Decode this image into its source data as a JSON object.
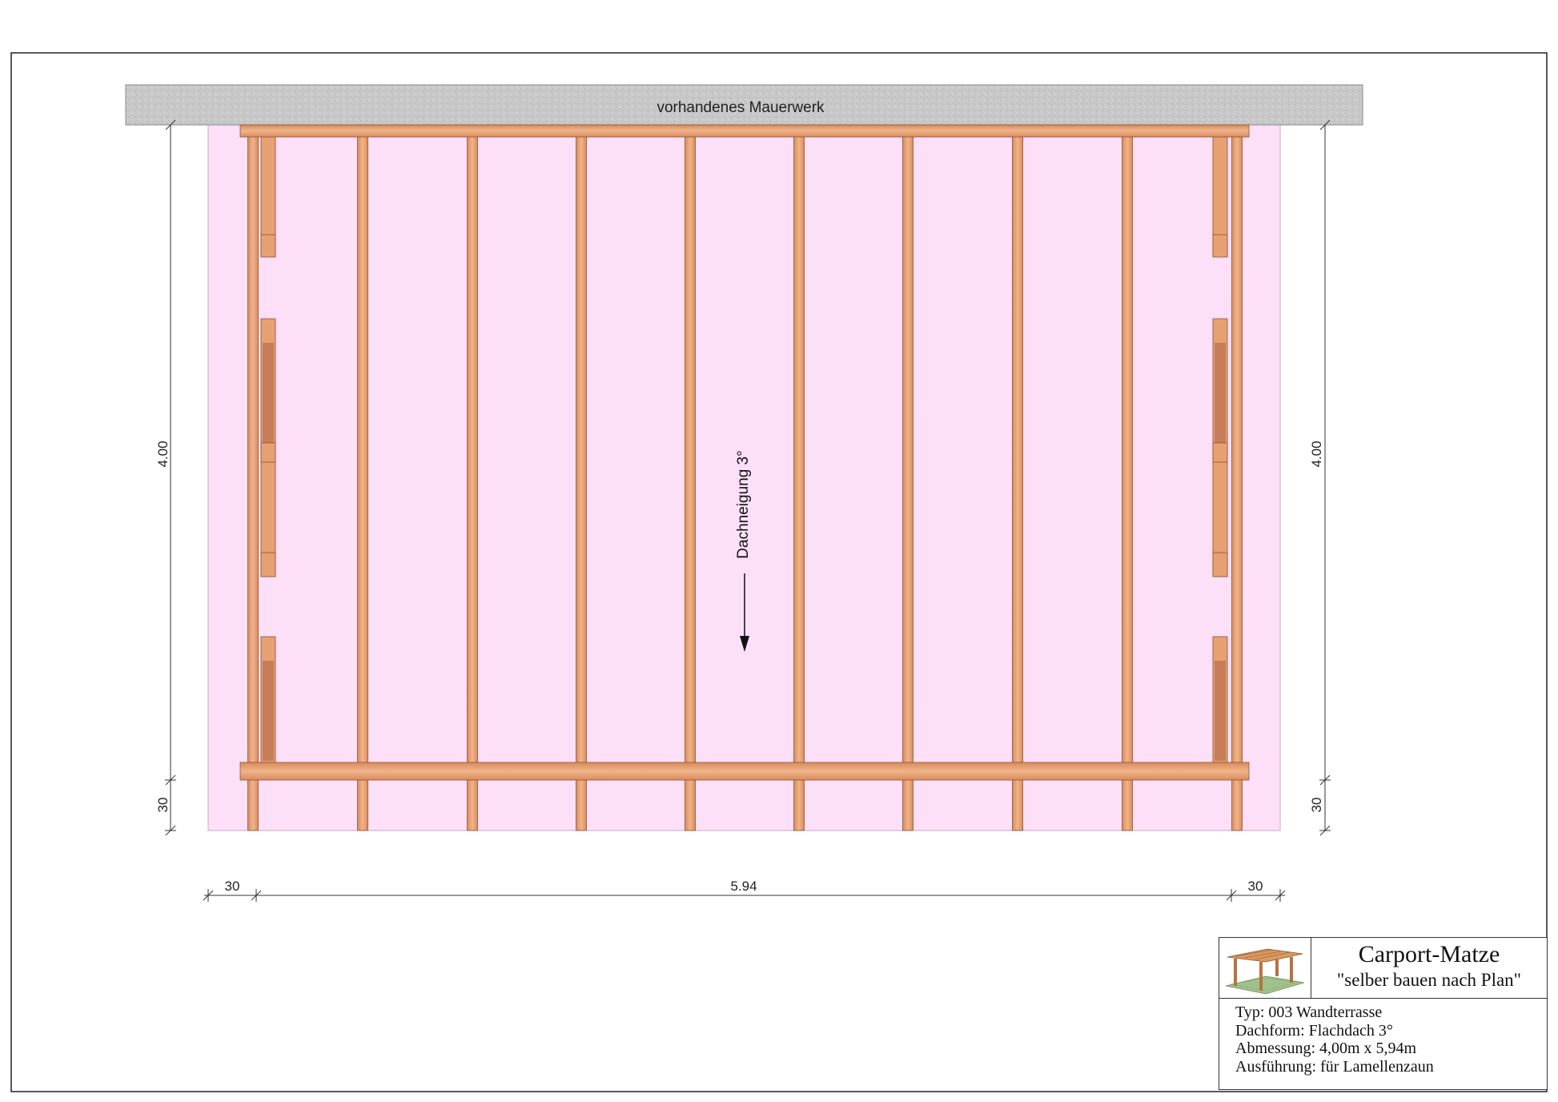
{
  "wall": {
    "label": "vorhandenes Mauerwerk"
  },
  "roof": {
    "slope_label": "Dachneigung 3°"
  },
  "dimensions": {
    "left_depth": "4.00",
    "left_overhang": "30",
    "right_depth": "4.00",
    "right_overhang": "30",
    "bottom_left_overhang": "30",
    "bottom_width": "5.94",
    "bottom_right_overhang": "30"
  },
  "colors": {
    "roof_fill": "#fde0f8",
    "timber": "#e9a77c",
    "timber_dark": "#c8784e",
    "wall_gray": "#c8c8c8"
  },
  "title_block": {
    "brand": "Carport-Matze",
    "slogan": "\"selber bauen nach Plan\"",
    "lines": [
      "Typ: 003 Wandterrasse",
      "Dachform: Flachdach 3°",
      "Abmessung: 4,00m x 5,94m",
      "Ausführung: für Lamellenzaun"
    ]
  }
}
